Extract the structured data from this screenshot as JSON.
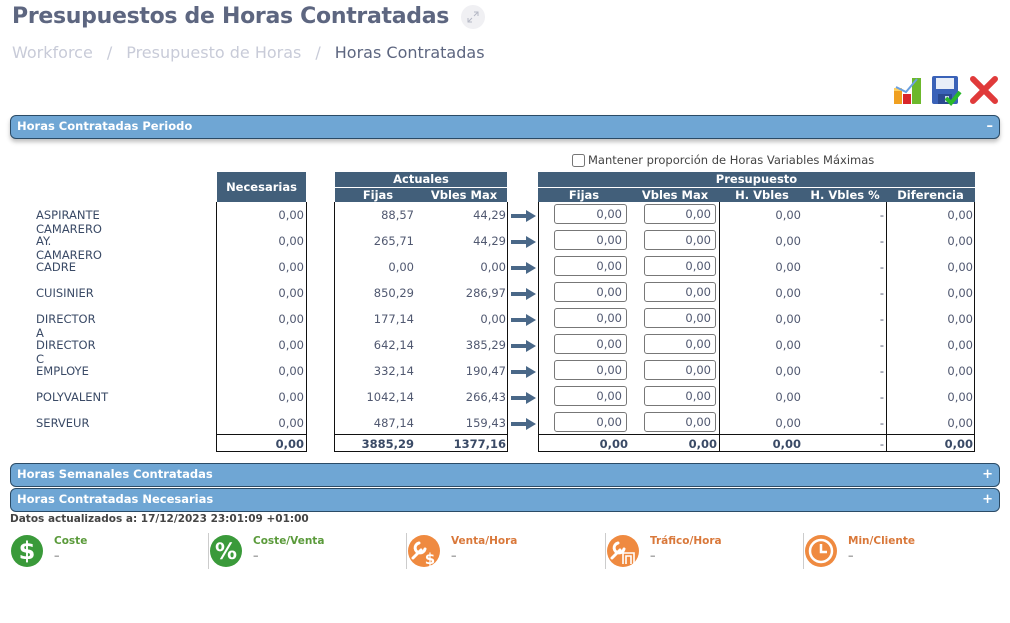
{
  "page": {
    "title": "Presupuestos de Horas Contratadas",
    "expand_icon": "expand-arrows-icon"
  },
  "breadcrumb": {
    "items": [
      "Workforce",
      "Presupuesto de Horas",
      "Horas Contratadas"
    ],
    "separator": "/"
  },
  "toolbar": {
    "buttons": [
      {
        "name": "chart",
        "icon": "bar-chart-icon"
      },
      {
        "name": "save",
        "icon": "save-check-icon"
      },
      {
        "name": "close",
        "icon": "red-x-icon"
      }
    ]
  },
  "panels": {
    "periodo": {
      "title": "Horas Contratadas Periodo",
      "toggle": "–"
    },
    "semanales": {
      "title": "Horas Semanales Contratadas",
      "toggle": "+"
    },
    "necesarias": {
      "title": "Horas Contratadas Necesarias",
      "toggle": "+"
    }
  },
  "table": {
    "keep_ratio_label": "Mantener proporción de Horas Variables Máximas",
    "keep_ratio_checked": false,
    "headers": {
      "necesarias": "Necesarias",
      "actuales": "Actuales",
      "actuales_fijas": "Fijas",
      "actuales_vbles": "Vbles Max",
      "presupuesto": "Presupuesto",
      "pres_fijas": "Fijas",
      "pres_vbles": "Vbles Max",
      "h_vbles": "H. Vbles",
      "h_vbles_pct": "H. Vbles %",
      "diferencia": "Diferencia"
    },
    "rows": [
      {
        "role": "ASPIRANTE CAMARERO",
        "necesarias": "0,00",
        "act_fijas": "88,57",
        "act_vbles": "44,29",
        "pres_fijas": "0,00",
        "pres_vbles": "0,00",
        "h_vbles": "0,00",
        "h_vbles_pct": "-",
        "diferencia": "0,00"
      },
      {
        "role": "AY. CAMARERO",
        "necesarias": "0,00",
        "act_fijas": "265,71",
        "act_vbles": "44,29",
        "pres_fijas": "0,00",
        "pres_vbles": "0,00",
        "h_vbles": "0,00",
        "h_vbles_pct": "-",
        "diferencia": "0,00"
      },
      {
        "role": "CADRE",
        "necesarias": "0,00",
        "act_fijas": "0,00",
        "act_vbles": "0,00",
        "pres_fijas": "0,00",
        "pres_vbles": "0,00",
        "h_vbles": "0,00",
        "h_vbles_pct": "-",
        "diferencia": "0,00"
      },
      {
        "role": "CUISINIER",
        "necesarias": "0,00",
        "act_fijas": "850,29",
        "act_vbles": "286,97",
        "pres_fijas": "0,00",
        "pres_vbles": "0,00",
        "h_vbles": "0,00",
        "h_vbles_pct": "-",
        "diferencia": "0,00"
      },
      {
        "role": "DIRECTOR A",
        "necesarias": "0,00",
        "act_fijas": "177,14",
        "act_vbles": "0,00",
        "pres_fijas": "0,00",
        "pres_vbles": "0,00",
        "h_vbles": "0,00",
        "h_vbles_pct": "-",
        "diferencia": "0,00"
      },
      {
        "role": "DIRECTOR C",
        "necesarias": "0,00",
        "act_fijas": "642,14",
        "act_vbles": "385,29",
        "pres_fijas": "0,00",
        "pres_vbles": "0,00",
        "h_vbles": "0,00",
        "h_vbles_pct": "-",
        "diferencia": "0,00"
      },
      {
        "role": "EMPLOYE",
        "necesarias": "0,00",
        "act_fijas": "332,14",
        "act_vbles": "190,47",
        "pres_fijas": "0,00",
        "pres_vbles": "0,00",
        "h_vbles": "0,00",
        "h_vbles_pct": "-",
        "diferencia": "0,00"
      },
      {
        "role": "POLYVALENT",
        "necesarias": "0,00",
        "act_fijas": "1042,14",
        "act_vbles": "266,43",
        "pres_fijas": "0,00",
        "pres_vbles": "0,00",
        "h_vbles": "0,00",
        "h_vbles_pct": "-",
        "diferencia": "0,00"
      },
      {
        "role": "SERVEUR",
        "necesarias": "0,00",
        "act_fijas": "487,14",
        "act_vbles": "159,43",
        "pres_fijas": "0,00",
        "pres_vbles": "0,00",
        "h_vbles": "0,00",
        "h_vbles_pct": "-",
        "diferencia": "0,00"
      }
    ],
    "totals": {
      "necesarias": "0,00",
      "act_fijas": "3885,29",
      "act_vbles": "1377,16",
      "pres_fijas": "0,00",
      "pres_vbles": "0,00",
      "h_vbles": "0,00",
      "h_vbles_pct": "-",
      "diferencia": "0,00"
    }
  },
  "updated": "Datos actualizados a: 17/12/2023 23:01:09 +01:00",
  "kpis": [
    {
      "label": "Coste",
      "value": "–",
      "icon": "dollar-icon",
      "color": "#3a9a3a"
    },
    {
      "label": "Coste/Venta",
      "value": "–",
      "icon": "percent-icon",
      "color": "#3a9a3a"
    },
    {
      "label": "Venta/Hora",
      "value": "–",
      "icon": "wrench-dollar-icon",
      "color": "#ef8a40"
    },
    {
      "label": "Tráfico/Hora",
      "value": "–",
      "icon": "wrench-door-icon",
      "color": "#ef8a40"
    },
    {
      "label": "Min/Cliente",
      "value": "–",
      "icon": "clock-icon",
      "color": "#ef8a40"
    }
  ]
}
